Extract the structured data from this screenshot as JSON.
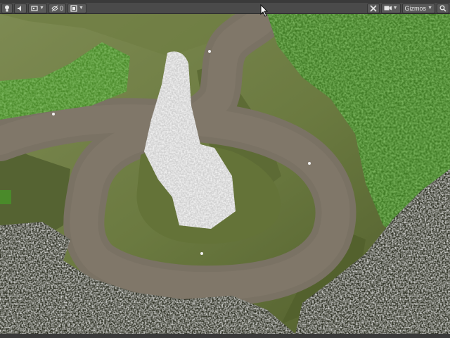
{
  "window": {
    "title": ""
  },
  "toolbar": {
    "left_buttons": [
      {
        "icon": "bulb-icon"
      },
      {
        "icon": "audio-icon"
      },
      {
        "icon": "image-effects-icon"
      },
      {
        "icon": "visibility-icon",
        "count": "0"
      },
      {
        "icon": "scene-camera-icon"
      }
    ],
    "right_buttons": [
      {
        "icon": "tools-icon"
      },
      {
        "icon": "camera-icon"
      },
      {
        "icon": "gizmos-dropdown",
        "label": "Gizmos"
      },
      {
        "icon": "search-icon"
      }
    ]
  },
  "scene": {
    "description_colors": {
      "terrain": "#6f7f46",
      "terrain_dark": "#55642f",
      "road": "#7a7264",
      "foliage_green": "#4d8a2f",
      "blossom": "#e3e3e3"
    }
  }
}
